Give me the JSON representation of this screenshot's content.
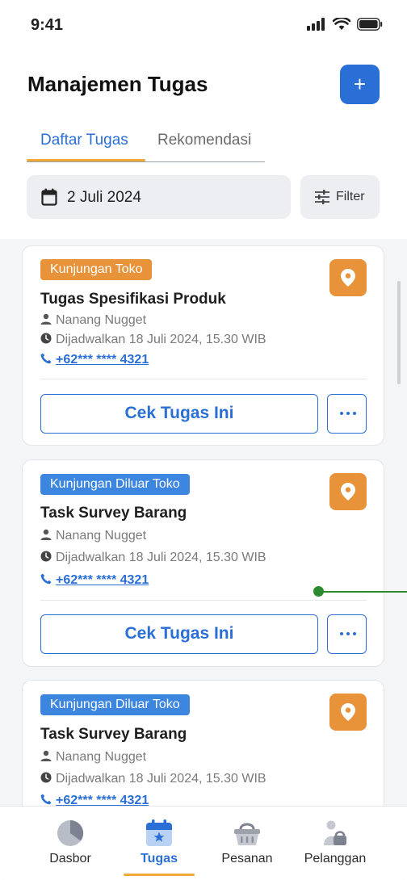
{
  "status_bar": {
    "time": "9:41"
  },
  "header": {
    "title": "Manajemen Tugas",
    "add_label": "+"
  },
  "tabs": [
    {
      "label": "Daftar Tugas",
      "active": true
    },
    {
      "label": "Rekomendasi",
      "active": false
    }
  ],
  "date_filter": {
    "value": "2 Juli 2024"
  },
  "filter": {
    "label": "Filter"
  },
  "tasks": [
    {
      "type": "Kunjungan Toko",
      "badge_color": "#e8923a",
      "title": "Tugas Spesifikasi Produk",
      "assignee": "Nanang Nugget",
      "schedule": "Dijadwalkan 18 Juli 2024, 15.30 WIB",
      "phone": "+62*** **** 4321",
      "action_label": "Cek Tugas Ini"
    },
    {
      "type": "Kunjungan Diluar Toko",
      "badge_color": "#3c86e0",
      "title": "Task Survey Barang",
      "assignee": "Nanang Nugget",
      "schedule": "Dijadwalkan 18 Juli 2024, 15.30 WIB",
      "phone": "+62*** **** 4321",
      "action_label": "Cek Tugas Ini"
    },
    {
      "type": "Kunjungan Diluar Toko",
      "badge_color": "#3c86e0",
      "title": "Task Survey Barang",
      "assignee": "Nanang Nugget",
      "schedule": "Dijadwalkan 18 Juli 2024, 15.30 WIB",
      "phone": "+62*** **** 4321"
    }
  ],
  "bottom_nav": [
    {
      "label": "Dasbor",
      "icon": "pie-chart-icon",
      "active": false
    },
    {
      "label": "Tugas",
      "icon": "calendar-star-icon",
      "active": true
    },
    {
      "label": "Pesanan",
      "icon": "basket-icon",
      "active": false
    },
    {
      "label": "Pelanggan",
      "icon": "user-lock-icon",
      "active": false
    }
  ],
  "colors": {
    "primary": "#2a6fd6",
    "accent": "#f0a839",
    "orange": "#e8923a",
    "blue_badge": "#3c86e0"
  }
}
